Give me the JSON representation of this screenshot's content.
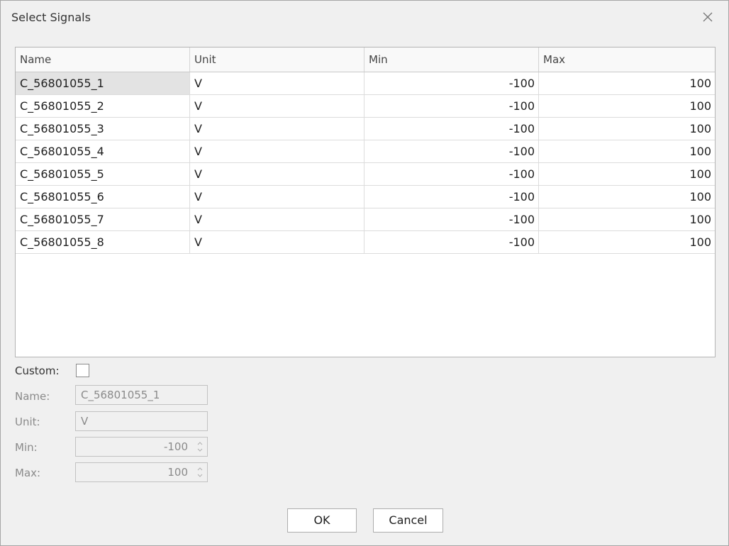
{
  "dialog": {
    "title": "Select Signals",
    "close_icon": "close-icon"
  },
  "grid": {
    "columns": [
      "Name",
      "Unit",
      "Min",
      "Max"
    ],
    "rows": [
      {
        "name": "C_56801055_1",
        "unit": "V",
        "min": "-100",
        "max": "100"
      },
      {
        "name": "C_56801055_2",
        "unit": "V",
        "min": "-100",
        "max": "100"
      },
      {
        "name": "C_56801055_3",
        "unit": "V",
        "min": "-100",
        "max": "100"
      },
      {
        "name": "C_56801055_4",
        "unit": "V",
        "min": "-100",
        "max": "100"
      },
      {
        "name": "C_56801055_5",
        "unit": "V",
        "min": "-100",
        "max": "100"
      },
      {
        "name": "C_56801055_6",
        "unit": "V",
        "min": "-100",
        "max": "100"
      },
      {
        "name": "C_56801055_7",
        "unit": "V",
        "min": "-100",
        "max": "100"
      },
      {
        "name": "C_56801055_8",
        "unit": "V",
        "min": "-100",
        "max": "100"
      }
    ],
    "selected_row": 0
  },
  "form": {
    "custom_label": "Custom:",
    "custom_checked": false,
    "name_label": "Name:",
    "name_value": "C_56801055_1",
    "unit_label": "Unit:",
    "unit_value": "V",
    "min_label": "Min:",
    "min_value": "-100",
    "max_label": "Max:",
    "max_value": "100"
  },
  "buttons": {
    "ok_label": "OK",
    "cancel_label": "Cancel"
  }
}
